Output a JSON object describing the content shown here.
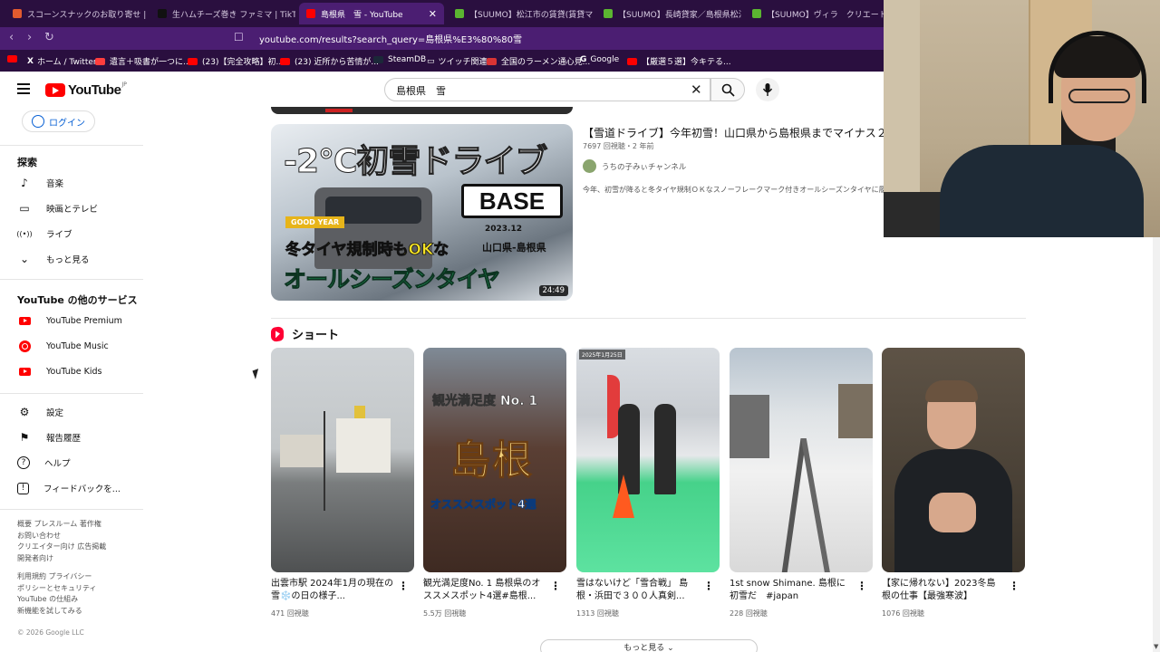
{
  "browser": {
    "tabs": [
      {
        "label": "スコーンスナックのお取り寄せ | 公式通販",
        "color": "#e25b2f",
        "active": false
      },
      {
        "label": "生ハムチーズ巻き ファミマ | TikTok",
        "color": "#111111",
        "active": false
      },
      {
        "label": "島根県　雪 - YouTube",
        "color": "#ff0000",
        "active": true
      },
      {
        "label": "【SUUMO】松江市の賃貸(賃貸マンション",
        "color": "#5bb531",
        "active": false
      },
      {
        "label": "【SUUMO】長崎貸家／島根県松江市",
        "color": "#5bb531",
        "active": false
      },
      {
        "label": "【SUUMO】ヴィラ　クリエートＡ／島根県",
        "color": "#5bb531",
        "active": false
      }
    ],
    "close_glyph": "✕",
    "url": "youtube.com/results?search_query=島根県%E3%80%80雪",
    "bookmarks": [
      {
        "label": "",
        "color": "#ff0000"
      },
      {
        "label": "ホーム / Twitter",
        "color": "#111111"
      },
      {
        "label": "遺言＋吸書が一つに...",
        "color": "#ff3d3d"
      },
      {
        "label": "(23)【完全攻略】初...",
        "color": "#ff0000"
      },
      {
        "label": "(23) 近所から苦情が...",
        "color": "#ff0000"
      },
      {
        "label": "SteamDB",
        "color": "#1b2838"
      },
      {
        "label": "ツイッチ関連",
        "color": "#ffcc33"
      },
      {
        "label": "全国のラーメン通心見...",
        "color": "#d93434"
      },
      {
        "label": "Google",
        "color": "#4285f4"
      },
      {
        "label": "【厳選５選】今キテる...",
        "color": "#ff0000"
      }
    ]
  },
  "header": {
    "logo_text": "YouTube",
    "logo_region": "JP",
    "search_value": "島根県　雪",
    "clear_glyph": "✕"
  },
  "sidebar": {
    "login_label": "ログイン",
    "explore_heading": "探索",
    "explore_items": [
      {
        "label": "音楽",
        "icon": "music-note-icon",
        "glyph": "♪"
      },
      {
        "label": "映画とテレビ",
        "icon": "film-icon",
        "glyph": "▭"
      },
      {
        "label": "ライブ",
        "icon": "live-icon",
        "glyph": "((•))"
      },
      {
        "label": "もっと見る",
        "icon": "chevron-down-icon",
        "glyph": "⌄"
      }
    ],
    "services_heading": "YouTube の他のサービス",
    "services_items": [
      {
        "label": "YouTube Premium",
        "icon": "youtube-premium-icon"
      },
      {
        "label": "YouTube Music",
        "icon": "youtube-music-icon"
      },
      {
        "label": "YouTube Kids",
        "icon": "youtube-kids-icon"
      }
    ],
    "settings_items": [
      {
        "label": "設定",
        "icon": "gear-icon",
        "glyph": "⚙"
      },
      {
        "label": "報告履歴",
        "icon": "flag-icon",
        "glyph": "⚑"
      },
      {
        "label": "ヘルプ",
        "icon": "help-icon",
        "glyph": "?"
      },
      {
        "label": "フィードバックを...",
        "icon": "feedback-icon",
        "glyph": "!"
      }
    ],
    "footer_links_1": [
      "概要 プレスルーム 著作権",
      "お問い合わせ",
      "クリエイター向け 広告掲載",
      "開発者向け"
    ],
    "footer_links_2": [
      "利用規約 プライバシー",
      "ポリシーとセキュリティ",
      "YouTube の仕組み",
      "新機能を試してみる"
    ],
    "copyright": "© 2026 Google LLC"
  },
  "video": {
    "thumb_title": "-2°C初雪ドライブ",
    "thumb_brand": "BASE",
    "thumb_badge": "GOOD YEAR",
    "thumb_date": "2023.12",
    "thumb_region": "山口県-島根県",
    "thumb_rule": "冬タイヤ規制時もOKな",
    "thumb_tire": "オールシーズンタイヤ",
    "duration": "24:49",
    "title": "【雪道ドライブ】今年初雪！山口県から島根県までマイナス２",
    "meta": "7697 回視聴・2 年前",
    "channel": "うちの子みぃチャンネル",
    "description": "今年、初雪が降ると冬タイヤ規制ＯＫなスノーフレークマーク付きオールシーズンタイヤに履"
  },
  "shorts": {
    "heading": "ショート",
    "items": [
      {
        "title": "出雲市駅 2024年1月の現在の雪❄️の日の様子...",
        "views": "471 回視聴"
      },
      {
        "title": "観光満足度No. 1 島根県のオススメスポット4選#島根...",
        "views": "5.5万 回視聴",
        "thumb_top": "観光満足度 No. 1",
        "thumb_big": "島根",
        "thumb_bottom": "オススメスポット4選"
      },
      {
        "title": "雪はないけど「雪合戦」 島根・浜田で３００人真剣...",
        "views": "1313 回視聴",
        "thumb_stamp": "2025年1月25日"
      },
      {
        "title": "1st snow Shimane. 島根に初雪だ　#japan #shimane...",
        "views": "228 回視聴"
      },
      {
        "title": "【家に帰れない】2023冬島根の仕事【最強寒波】",
        "views": "1076 回視聴"
      }
    ],
    "more_glyph": "⋮",
    "show_more_label": "もっと見る ⌄"
  }
}
